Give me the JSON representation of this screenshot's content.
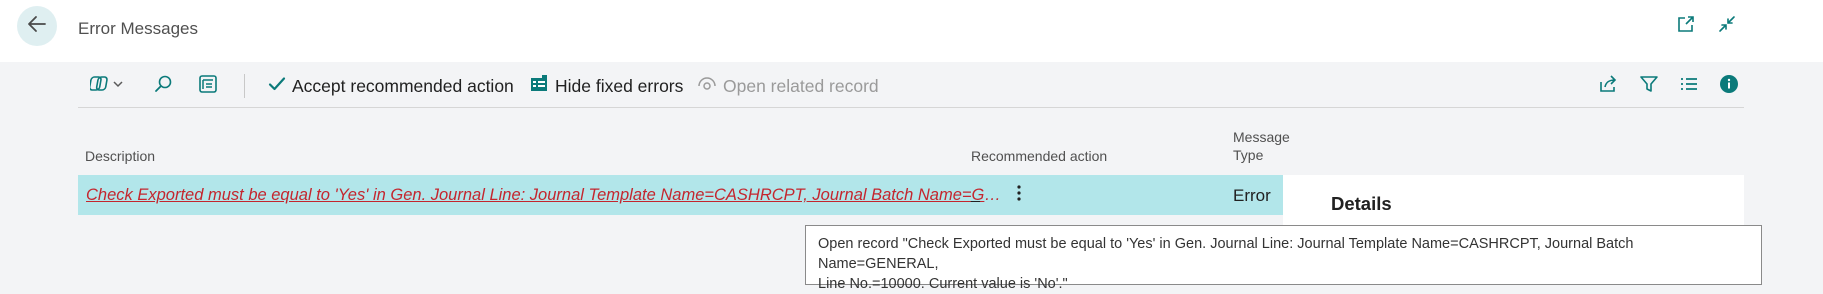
{
  "header": {
    "title": "Error Messages",
    "back_icon": "arrow-left-icon",
    "open_new_window_icon": "open-in-new-window-icon",
    "collapse_icon": "collapse-icon"
  },
  "toolbar": {
    "actions": [
      {
        "label": "Accept recommended action",
        "icon": "checkmark-icon",
        "enabled": true
      },
      {
        "label": "Hide fixed errors",
        "icon": "filter-list-icon",
        "enabled": true
      },
      {
        "label": "Open related record",
        "icon": "open-record-icon",
        "enabled": false
      }
    ],
    "left_icons": [
      "copilot-dropdown-icon",
      "search-icon",
      "edit-list-icon"
    ],
    "right_icons": [
      "share-icon",
      "filter-icon",
      "list-view-icon",
      "info-icon"
    ]
  },
  "table": {
    "columns": {
      "description": "Description",
      "recommended_action": "Recommended action",
      "message_type_line1": "Message",
      "message_type_line2": "Type"
    },
    "rows": [
      {
        "description": "Check Exported must be equal to 'Yes'  in Gen. Journal Line: Journal Template Name=CASHRCPT, Journal Batch Name=GENERAL, Line No.=10000. Current value is 'No'.",
        "recommended_action": "_",
        "message_type": "Error"
      }
    ]
  },
  "details": {
    "title": "Details"
  },
  "tooltip": {
    "line1": "Open record \"Check Exported must be equal to 'Yes'  in Gen. Journal Line: Journal Template Name=CASHRCPT, Journal Batch Name=GENERAL,",
    "line2": "Line No.=10000. Current value is 'No'.\""
  },
  "colors": {
    "accent": "#0b7a7a",
    "row_selected": "#b2e6ea",
    "error_text": "#c4262e"
  }
}
